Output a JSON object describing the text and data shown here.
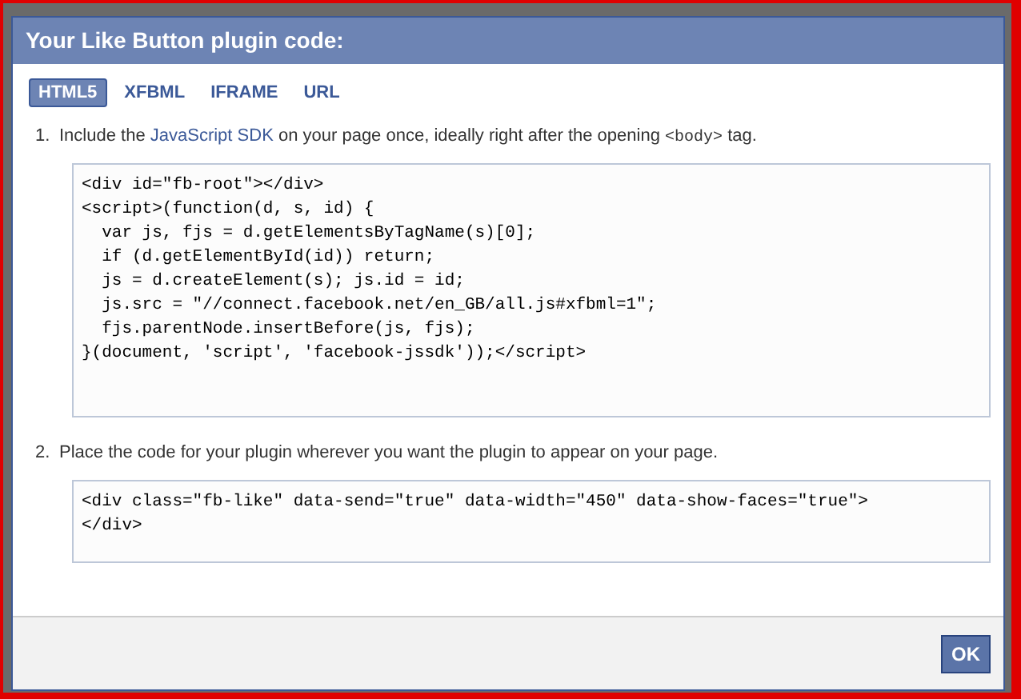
{
  "dialog": {
    "title": "Your Like Button plugin code:"
  },
  "tabs": [
    {
      "label": "HTML5",
      "selected": true
    },
    {
      "label": "XFBML",
      "selected": false
    },
    {
      "label": "IFRAME",
      "selected": false
    },
    {
      "label": "URL",
      "selected": false
    }
  ],
  "steps": [
    {
      "number": "1.",
      "text_before": "Include the ",
      "link": "JavaScript SDK",
      "text_middle": " on your page once, ideally right after the opening ",
      "code_word": "<body>",
      "text_after": " tag.",
      "code": "<div id=\"fb-root\"></div>\n<script>(function(d, s, id) {\n  var js, fjs = d.getElementsByTagName(s)[0];\n  if (d.getElementById(id)) return;\n  js = d.createElement(s); js.id = id;\n  js.src = \"//connect.facebook.net/en_GB/all.js#xfbml=1\";\n  fjs.parentNode.insertBefore(js, fjs);\n}(document, 'script', 'facebook-jssdk'));</script>"
    },
    {
      "number": "2.",
      "text_before": "Place the code for your plugin wherever you want the plugin to appear on your page.",
      "code": "<div class=\"fb-like\" data-send=\"true\" data-width=\"450\" data-show-faces=\"true\">\n</div>"
    }
  ],
  "ok_button": "OK"
}
